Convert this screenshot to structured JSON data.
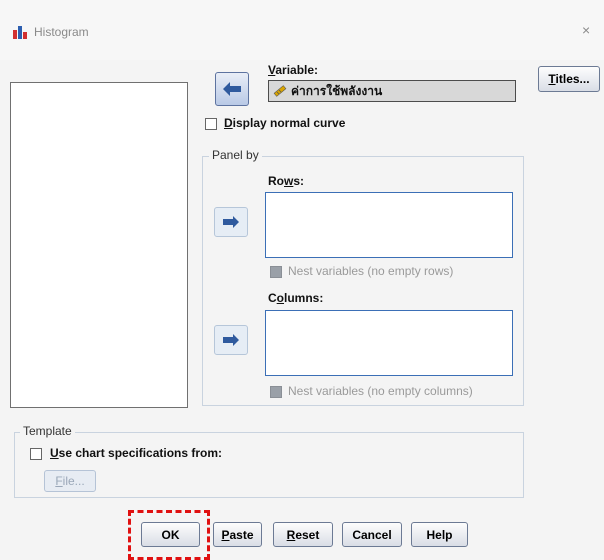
{
  "window": {
    "title": "Histogram",
    "close_glyph": "×",
    "icon": "histogram-app-icon"
  },
  "variable": {
    "label": "Variable:",
    "value": "ค่าการใช้พลังงาน",
    "icon": "scale-variable-icon"
  },
  "buttons": {
    "titles": "Titles...",
    "ok": "OK",
    "paste": "Paste",
    "reset": "Reset",
    "cancel": "Cancel",
    "help": "Help",
    "file": "File..."
  },
  "display_normal_curve": {
    "label": "Display normal curve",
    "checked": false
  },
  "panel_by": {
    "legend": "Panel by",
    "rows": {
      "label": "Rows:",
      "nest_label": "Nest variables (no empty rows)"
    },
    "columns": {
      "label": "Columns:",
      "nest_label": "Nest variables (no empty columns)"
    }
  },
  "template": {
    "legend": "Template",
    "use_chart_label": "Use chart specifications from:",
    "checked": false
  },
  "colors": {
    "highlight": "#e01010",
    "field_border": "#3b6fb6",
    "arrow": "#2f5a9e"
  }
}
